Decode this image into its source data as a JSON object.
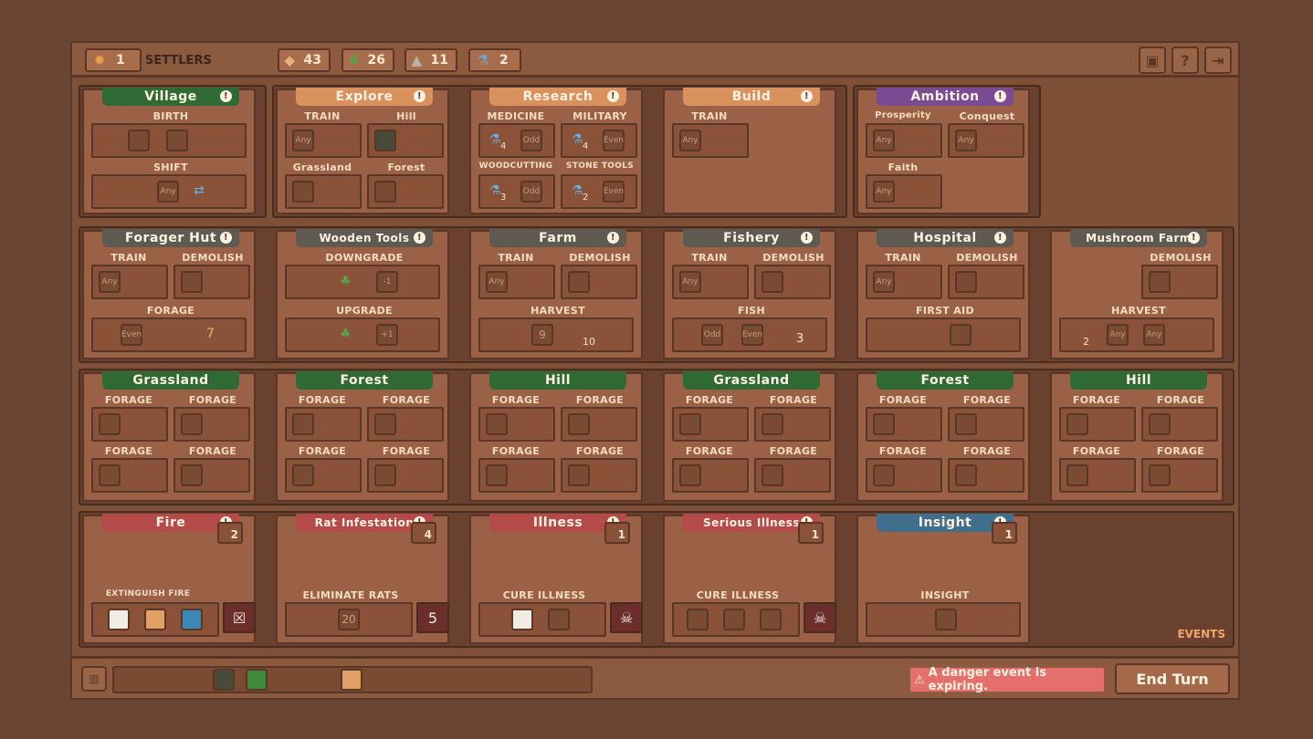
{
  "topbar": {
    "settlers_count": "1",
    "settlers_label": "SETTLERS",
    "food": "43",
    "wood": "26",
    "stone": "11",
    "potion": "2"
  },
  "cards": {
    "village": {
      "title": "Village",
      "a": "BIRTH",
      "b": "SHIFT"
    },
    "explore": {
      "title": "Explore",
      "a": "TRAIN",
      "b": "Hill",
      "c": "Grassland",
      "d": "Forest",
      "any": "Any"
    },
    "research": {
      "title": "Research",
      "a": "MEDICINE",
      "b": "MILITARY",
      "c": "WOODCUTTING",
      "d": "STONE TOOLS",
      "n1": "4",
      "n2": "4",
      "n3": "3",
      "n4": "2",
      "odd": "Odd",
      "even": "Even"
    },
    "build": {
      "title": "Build",
      "a": "TRAIN",
      "any": "Any"
    },
    "ambition": {
      "title": "Ambition",
      "a": "Prosperity",
      "b": "Conquest",
      "c": "Faith",
      "any": "Any"
    },
    "forager": {
      "title": "Forager Hut",
      "a": "TRAIN",
      "b": "DEMOLISH",
      "c": "FORAGE",
      "any": "Any",
      "even": "Even",
      "n": "7"
    },
    "tools": {
      "title": "Wooden Tools",
      "a": "DOWNGRADE",
      "b": "UPGRADE",
      "m": "-1",
      "p": "+1"
    },
    "farm": {
      "title": "Farm",
      "a": "TRAIN",
      "b": "DEMOLISH",
      "c": "HARVEST",
      "any": "Any",
      "n": "9",
      "r": "10"
    },
    "fishery": {
      "title": "Fishery",
      "a": "TRAIN",
      "b": "DEMOLISH",
      "c": "FISH",
      "any": "Any",
      "odd": "Odd",
      "even": "Even",
      "r": "3"
    },
    "hospital": {
      "title": "Hospital",
      "a": "TRAIN",
      "b": "DEMOLISH",
      "c": "FIRST AID",
      "any": "Any"
    },
    "mushroom": {
      "title": "Mushroom Farm",
      "a": "DEMOLISH",
      "b": "HARVEST",
      "any": "Any",
      "n": "2"
    }
  },
  "forage_row": [
    {
      "title": "Grassland"
    },
    {
      "title": "Forest"
    },
    {
      "title": "Hill"
    },
    {
      "title": "Grassland"
    },
    {
      "title": "Forest"
    },
    {
      "title": "Hill"
    }
  ],
  "forage_label": "FORAGE",
  "events": {
    "fire": {
      "title": "Fire",
      "turns": "2",
      "action": "EXTINGUISH FIRE"
    },
    "rats": {
      "title": "Rat Infestation",
      "turns": "4",
      "action": "ELIMINATE RATS",
      "n": "20",
      "k": "5"
    },
    "illness": {
      "title": "Illness",
      "turns": "1",
      "action": "CURE ILLNESS"
    },
    "serious": {
      "title": "Serious Illness",
      "turns": "1",
      "action": "CURE ILLNESS"
    },
    "insight": {
      "title": "Insight",
      "turns": "1",
      "action": "INSIGHT"
    },
    "label": "EVENTS"
  },
  "bottom": {
    "warning": "A danger event is expiring.",
    "end_turn": "End Turn"
  }
}
